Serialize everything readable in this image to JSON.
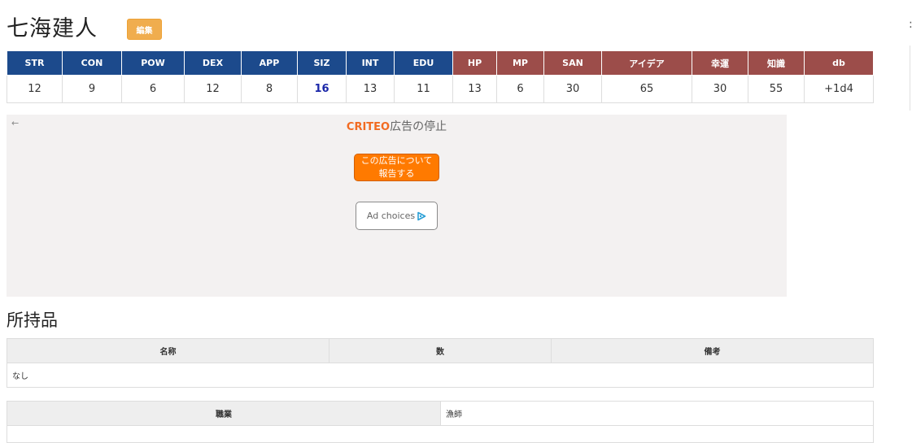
{
  "character": {
    "name": "七海建人",
    "edit_label": "編集"
  },
  "stats": {
    "headers": [
      "STR",
      "CON",
      "POW",
      "DEX",
      "APP",
      "SIZ",
      "INT",
      "EDU",
      "HP",
      "MP",
      "SAN",
      "アイデア",
      "幸運",
      "知識",
      "db"
    ],
    "values": [
      "12",
      "9",
      "6",
      "12",
      "8",
      "16",
      "13",
      "11",
      "13",
      "6",
      "30",
      "65",
      "30",
      "55",
      "+1d4"
    ],
    "header_colors": {
      "primary": "#1c4a8c",
      "derived": "#9c4d4a"
    },
    "highlight_color": "#1a26a8"
  },
  "ad": {
    "back_icon": "←",
    "brand": "CRITEO",
    "stop_label": "広告の停止",
    "report_label": "この広告について\n報告する",
    "choices_label": "Ad choices",
    "brand_color": "#f26b21",
    "report_color": "#ff7a00"
  },
  "inventory": {
    "title": "所持品",
    "headers": [
      "名称",
      "数",
      "備考"
    ],
    "empty_text": "なし"
  },
  "profile": {
    "job_label": "職業",
    "job_value": "漁師"
  },
  "edge": {
    "mark": ":"
  }
}
